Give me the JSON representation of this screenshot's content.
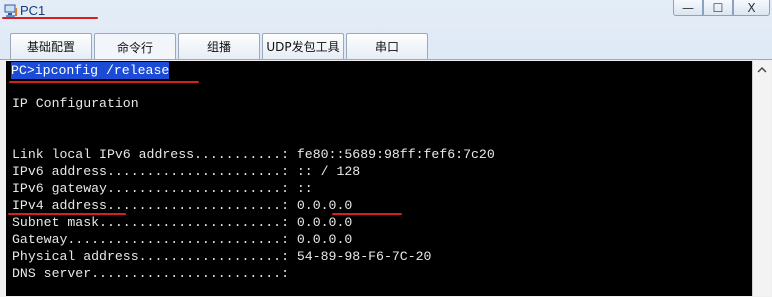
{
  "window": {
    "title": "PC1",
    "buttons": {
      "minimize": "—",
      "maximize": "☐",
      "close": "X"
    }
  },
  "tabs": [
    {
      "label": "基础配置"
    },
    {
      "label": "命令行"
    },
    {
      "label": "组播"
    },
    {
      "label": "UDP发包工具"
    },
    {
      "label": "串口"
    }
  ],
  "active_tab": "命令行",
  "terminal": {
    "command": "PC>ipconfig /release",
    "lines": [
      "IP Configuration",
      "",
      "",
      "Link local IPv6 address...........: fe80::5689:98ff:fef6:7c20",
      "IPv6 address......................: :: / 128",
      "IPv6 gateway......................: ::",
      "IPv4 address......................: 0.0.0.0",
      "Subnet mask.......................: 0.0.0.0",
      "Gateway...........................: 0.0.0.0",
      "Physical address..................: 54-89-98-F6-7C-20",
      "DNS server........................:"
    ]
  },
  "colors": {
    "annotation_red": "#d62020",
    "selection_blue": "#1c4bd6",
    "terminal_bg": "#000000",
    "terminal_fg": "#e8e8e8"
  }
}
